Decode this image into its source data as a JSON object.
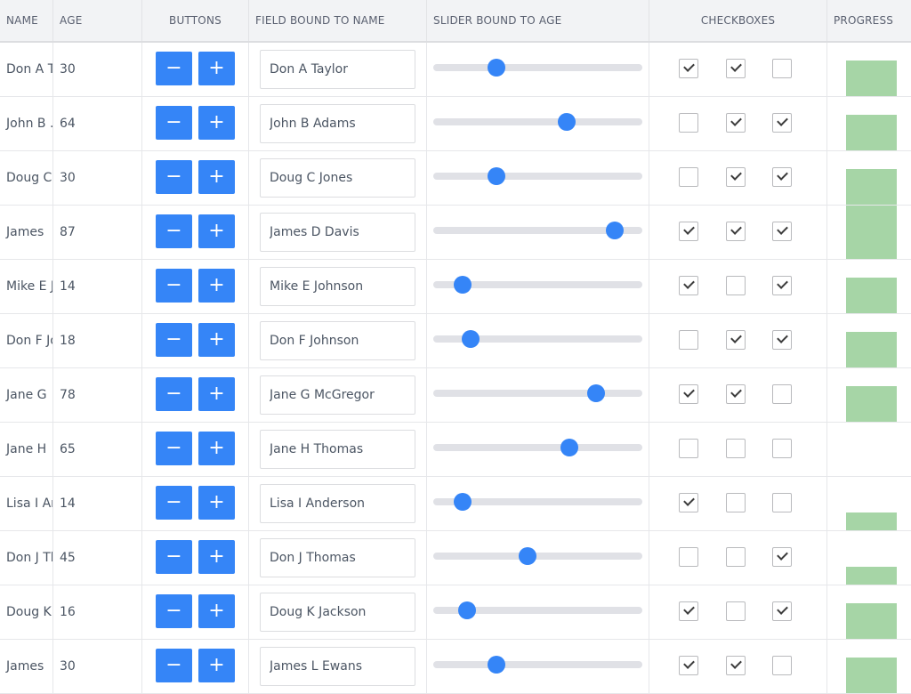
{
  "columns": {
    "name": "NAME",
    "age": "AGE",
    "buttons": "BUTTONS",
    "field": "FIELD BOUND TO NAME",
    "slider": "SLIDER BOUND TO AGE",
    "checkboxes": "CHECKBOXES",
    "progress": "PROGRESS"
  },
  "buttons": {
    "decrement_label": "−",
    "increment_label": "+"
  },
  "colors": {
    "accent": "#3585f7",
    "progress": "#a6d5a6",
    "header_bg": "#f2f3f5"
  },
  "slider_range": [
    0,
    100
  ],
  "rows": [
    {
      "name_cell": "Don A T",
      "age": "30",
      "field": "Don A Taylor",
      "slider": 30,
      "checks": [
        true,
        true,
        false
      ],
      "progress": 0.67
    },
    {
      "name_cell": "John B .",
      "age": "64",
      "field": "John B Adams",
      "slider": 64,
      "checks": [
        false,
        true,
        true
      ],
      "progress": 0.67
    },
    {
      "name_cell": "Doug C",
      "age": "30",
      "field": "Doug C Jones",
      "slider": 30,
      "checks": [
        false,
        true,
        true
      ],
      "progress": 0.67
    },
    {
      "name_cell": "James",
      "age": "87",
      "field": "James D Davis",
      "slider": 87,
      "checks": [
        true,
        true,
        true
      ],
      "progress": 1.0
    },
    {
      "name_cell": "Mike E J",
      "age": "14",
      "field": "Mike E Johnson",
      "slider": 14,
      "checks": [
        true,
        false,
        true
      ],
      "progress": 0.67
    },
    {
      "name_cell": "Don F Jo",
      "age": "18",
      "field": "Don F Johnson",
      "slider": 18,
      "checks": [
        false,
        true,
        true
      ],
      "progress": 0.67
    },
    {
      "name_cell": "Jane G",
      "age": "78",
      "field": "Jane G McGregor",
      "slider": 78,
      "checks": [
        true,
        true,
        false
      ],
      "progress": 0.67
    },
    {
      "name_cell": "Jane H",
      "age": "65",
      "field": "Jane H Thomas",
      "slider": 65,
      "checks": [
        false,
        false,
        false
      ],
      "progress": 0
    },
    {
      "name_cell": "Lisa I Ar",
      "age": "14",
      "field": "Lisa I Anderson",
      "slider": 14,
      "checks": [
        true,
        false,
        false
      ],
      "progress": 0.33
    },
    {
      "name_cell": "Don J Th",
      "age": "45",
      "field": "Don J Thomas",
      "slider": 45,
      "checks": [
        false,
        false,
        true
      ],
      "progress": 0.33
    },
    {
      "name_cell": "Doug K",
      "age": "16",
      "field": "Doug K Jackson",
      "slider": 16,
      "checks": [
        true,
        false,
        true
      ],
      "progress": 0.67
    },
    {
      "name_cell": "James",
      "age": "30",
      "field": "James L Ewans",
      "slider": 30,
      "checks": [
        true,
        true,
        false
      ],
      "progress": 0.67
    }
  ]
}
